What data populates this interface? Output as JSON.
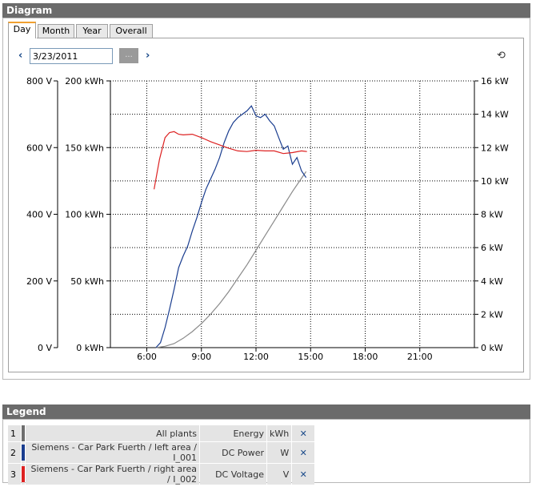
{
  "diagram_panel": {
    "title": "Diagram"
  },
  "tabs": [
    {
      "label": "Day",
      "active": true
    },
    {
      "label": "Month",
      "active": false
    },
    {
      "label": "Year",
      "active": false
    },
    {
      "label": "Overall",
      "active": false
    }
  ],
  "date_nav": {
    "prev_icon": "chevron-left-icon",
    "date_value": "3/23/2011",
    "picker_label": "...",
    "next_icon": "chevron-right-icon",
    "refresh_icon": "refresh-icon"
  },
  "chart_data": {
    "type": "line",
    "x_ticks": [
      "6:00",
      "9:00",
      "12:00",
      "15:00",
      "18:00",
      "21:00"
    ],
    "x_range_hours": [
      4,
      24
    ],
    "y_axes": [
      {
        "side": "left-outer",
        "unit": "V",
        "range": [
          0,
          800
        ],
        "ticks": [
          "0 V",
          "200 V",
          "400 V",
          "600 V",
          "800 V"
        ]
      },
      {
        "side": "left-inner",
        "unit": "kWh",
        "range": [
          0,
          200
        ],
        "ticks": [
          "0 kWh",
          "50 kWh",
          "100 kWh",
          "150 kWh",
          "200 kWh"
        ]
      },
      {
        "side": "right",
        "unit": "kW",
        "range": [
          0,
          16
        ],
        "ticks": [
          "0 kW",
          "2 kW",
          "4 kW",
          "6 kW",
          "8 kW",
          "10 kW",
          "12 kW",
          "14 kW",
          "16 kW"
        ]
      }
    ],
    "grid": true,
    "series": [
      {
        "name": "Energy",
        "unit": "kWh",
        "color": "#8a8a8a",
        "points": [
          [
            6.5,
            0
          ],
          [
            7,
            1
          ],
          [
            7.5,
            3
          ],
          [
            8,
            7
          ],
          [
            8.5,
            12
          ],
          [
            9,
            18
          ],
          [
            9.5,
            25
          ],
          [
            10,
            33
          ],
          [
            10.5,
            42
          ],
          [
            11,
            52
          ],
          [
            11.5,
            62
          ],
          [
            12,
            73
          ],
          [
            12.5,
            84
          ],
          [
            13,
            95
          ],
          [
            13.5,
            106
          ],
          [
            14,
            117
          ],
          [
            14.5,
            127
          ],
          [
            14.75,
            132
          ]
        ]
      },
      {
        "name": "DC Power",
        "unit": "W",
        "color": "#1a3d8f",
        "points": [
          [
            6.5,
            0
          ],
          [
            6.75,
            300
          ],
          [
            7,
            1200
          ],
          [
            7.25,
            2300
          ],
          [
            7.5,
            3500
          ],
          [
            7.75,
            4800
          ],
          [
            8,
            5500
          ],
          [
            8.25,
            6100
          ],
          [
            8.5,
            7000
          ],
          [
            8.75,
            7800
          ],
          [
            9,
            8700
          ],
          [
            9.25,
            9500
          ],
          [
            9.5,
            10100
          ],
          [
            9.75,
            10700
          ],
          [
            10,
            11400
          ],
          [
            10.25,
            12300
          ],
          [
            10.5,
            13000
          ],
          [
            10.75,
            13500
          ],
          [
            11,
            13800
          ],
          [
            11.25,
            14000
          ],
          [
            11.5,
            14200
          ],
          [
            11.75,
            14500
          ],
          [
            12,
            13900
          ],
          [
            12.25,
            13800
          ],
          [
            12.5,
            14000
          ],
          [
            12.75,
            13600
          ],
          [
            13,
            13300
          ],
          [
            13.25,
            12600
          ],
          [
            13.5,
            11900
          ],
          [
            13.75,
            12100
          ],
          [
            14,
            11000
          ],
          [
            14.25,
            11400
          ],
          [
            14.5,
            10600
          ],
          [
            14.75,
            10200
          ]
        ]
      },
      {
        "name": "DC Voltage",
        "unit": "V",
        "color": "#dd2222",
        "points": [
          [
            6.4,
            475
          ],
          [
            6.7,
            565
          ],
          [
            7,
            630
          ],
          [
            7.25,
            645
          ],
          [
            7.5,
            648
          ],
          [
            7.75,
            640
          ],
          [
            8,
            638
          ],
          [
            8.5,
            640
          ],
          [
            9,
            630
          ],
          [
            9.5,
            618
          ],
          [
            10,
            608
          ],
          [
            10.5,
            598
          ],
          [
            11,
            590
          ],
          [
            11.5,
            588
          ],
          [
            12,
            592
          ],
          [
            12.5,
            590
          ],
          [
            13,
            590
          ],
          [
            13.5,
            582
          ],
          [
            14,
            585
          ],
          [
            14.5,
            590
          ],
          [
            14.8,
            588
          ]
        ]
      }
    ]
  },
  "legend_panel": {
    "title": "Legend",
    "rows": [
      {
        "index": "1",
        "plant": "All plants",
        "channel": "Energy",
        "unit": "kWh",
        "color": "#6e6e6e"
      },
      {
        "index": "2",
        "plant": "Siemens - Car Park Fuerth / left area / I_001",
        "channel": "DC Power",
        "unit": "W",
        "color": "#1a3d8f"
      },
      {
        "index": "3",
        "plant": "Siemens - Car Park Fuerth / right area / I_002",
        "channel": "DC Voltage",
        "unit": "V",
        "color": "#dd2222"
      }
    ],
    "delete_icon": "delete-x-icon"
  }
}
